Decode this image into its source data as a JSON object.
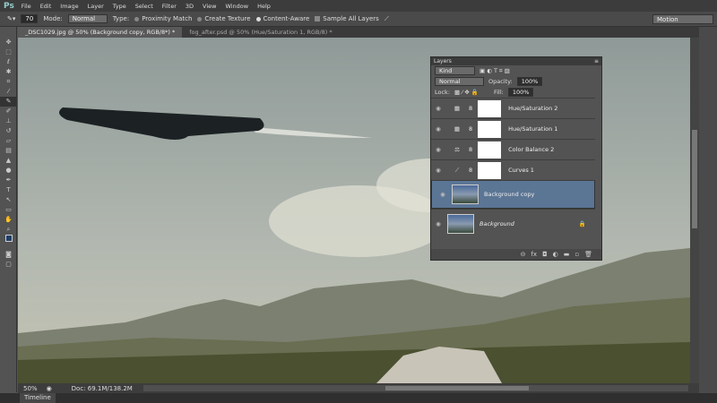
{
  "app": {
    "logo": "Ps",
    "menu": [
      "File",
      "Edit",
      "Image",
      "Layer",
      "Type",
      "Select",
      "Filter",
      "3D",
      "View",
      "Window",
      "Help"
    ]
  },
  "options": {
    "brush_size": "70",
    "mode_label": "Mode:",
    "mode": "Normal",
    "type_label": "Type:",
    "types": [
      "Proximity Match",
      "Create Texture",
      "Content-Aware"
    ],
    "selected_type": "Content-Aware",
    "sample_all": "Sample All Layers",
    "workspace": "Motion"
  },
  "tabs": [
    {
      "label": "_DSC1029.jpg @ 50% (Background copy, RGB/8*) *",
      "active": true
    },
    {
      "label": "fog_after.psd @ 50% (Hue/Saturation 1, RGB/8) *",
      "active": false
    }
  ],
  "status": {
    "zoom": "50%",
    "doc": "Doc: 69.1M/138.2M"
  },
  "timeline": "Timeline",
  "layers_panel": {
    "title": "Layers",
    "kind": "Kind",
    "blend": "Normal",
    "opacity_label": "Opacity:",
    "opacity": "100%",
    "lock_label": "Lock:",
    "fill_label": "Fill:",
    "fill": "100%",
    "layers": [
      {
        "name": "Hue/Saturation 2",
        "type": "adjustment",
        "icon": "hue-sat"
      },
      {
        "name": "Hue/Saturation 1",
        "type": "adjustment",
        "icon": "hue-sat"
      },
      {
        "name": "Color Balance 2",
        "type": "adjustment",
        "icon": "color-balance"
      },
      {
        "name": "Curves 1",
        "type": "adjustment",
        "icon": "curves"
      },
      {
        "name": "Background copy",
        "type": "pixel",
        "selected": true
      },
      {
        "name": "Background",
        "type": "pixel",
        "locked": true
      }
    ],
    "footer_icons": [
      "link",
      "fx",
      "mask",
      "adjustment",
      "folder",
      "new-layer",
      "trash"
    ]
  }
}
